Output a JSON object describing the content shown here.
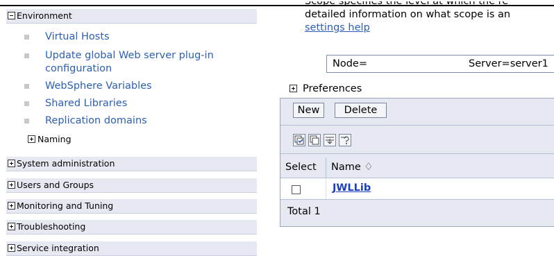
{
  "nav": {
    "environment": {
      "label": "Environment",
      "expanded": true
    },
    "environment_items": [
      {
        "label": "Virtual Hosts"
      },
      {
        "label": "Update global Web server plug-in",
        "label2": "configuration"
      },
      {
        "label": "WebSphere Variables"
      },
      {
        "label": "Shared Libraries"
      },
      {
        "label": "Replication domains"
      }
    ],
    "naming": {
      "label": "Naming",
      "expanded": false
    },
    "sections": [
      {
        "label": "System administration"
      },
      {
        "label": "Users and Groups"
      },
      {
        "label": "Monitoring and Tuning"
      },
      {
        "label": "Troubleshooting"
      },
      {
        "label": "Service integration"
      }
    ]
  },
  "main": {
    "scope_line0": "Scope specifies the level at which the re",
    "scope_line1": "detailed information on what scope is an",
    "settings_help": "settings help",
    "scope_node": "Node=",
    "scope_server": "Server=server1",
    "preferences_label": "Preferences",
    "new_button": "New",
    "delete_button": "Delete",
    "icons": [
      "select-all-icon",
      "deselect-all-icon",
      "show-filter-icon",
      "clear-filter-icon"
    ],
    "table": {
      "col_select": "Select",
      "col_name": "Name",
      "sort_glyph": "♢",
      "rows": [
        {
          "name": "JWLLib",
          "checked": false
        }
      ],
      "total": "Total 1"
    }
  },
  "colors": {
    "nav_header_bg": "#e6e9f2",
    "link": "#2c5fb3",
    "panel_bg": "#e6e9f2"
  }
}
